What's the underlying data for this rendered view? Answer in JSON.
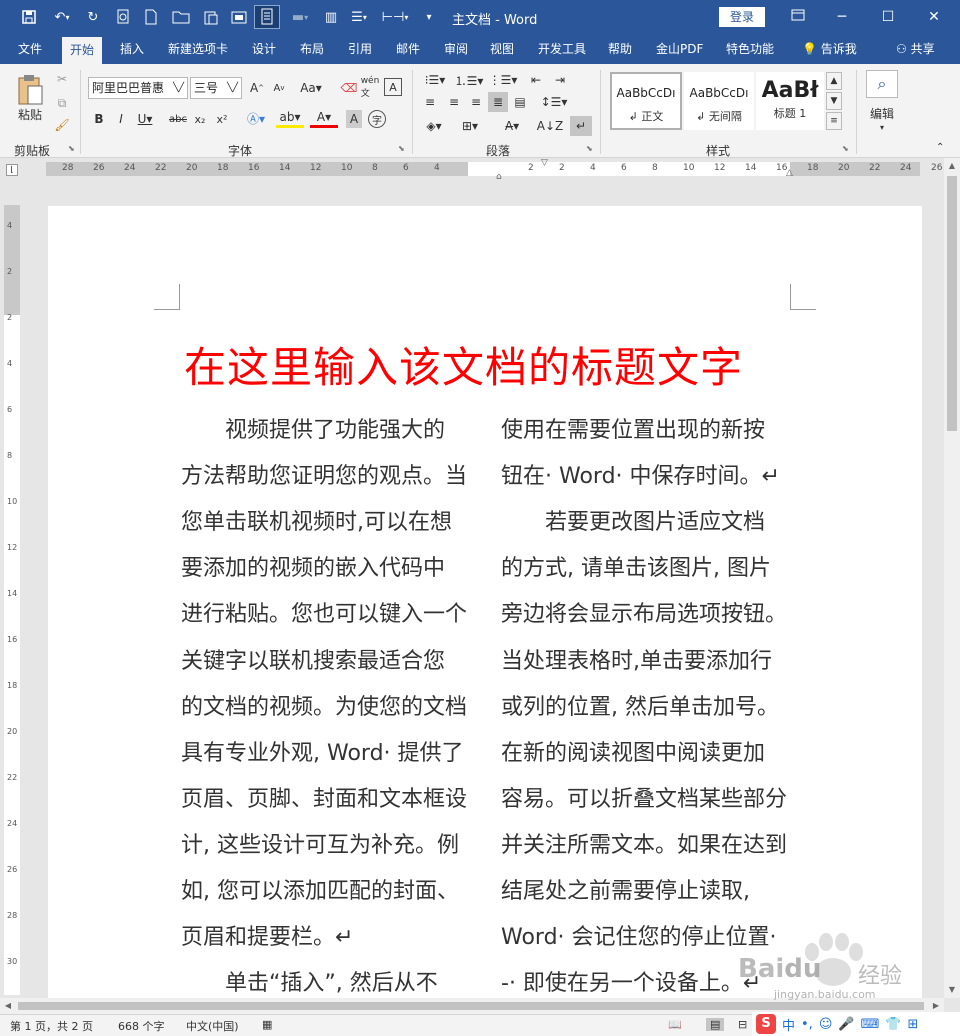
{
  "title_bar": {
    "doc_title": "主文档 - Word",
    "login_label": "登录"
  },
  "tabs": [
    "文件",
    "开始",
    "插入",
    "新建选项卡",
    "设计",
    "布局",
    "引用",
    "邮件",
    "审阅",
    "视图",
    "开发工具",
    "帮助",
    "金山PDF",
    "特色功能",
    "告诉我",
    "共享"
  ],
  "ribbon": {
    "paste_label": "粘贴",
    "font_name": "阿里巴巴普惠",
    "font_size": "三号",
    "groups": [
      "剪贴板",
      "字体",
      "段落",
      "样式",
      "编辑"
    ],
    "styles": [
      {
        "preview": "AaBbCcDı",
        "name": "正文"
      },
      {
        "preview": "AaBbCcDı",
        "name": "无间隔"
      },
      {
        "preview": "AaBł",
        "name": "标题 1"
      }
    ],
    "edit_label": "编辑"
  },
  "ruler": {
    "left_numbers": [
      "28",
      "26",
      "24",
      "22",
      "20",
      "18",
      "16",
      "14",
      "12",
      "10",
      "8",
      "6",
      "4"
    ],
    "right_numbers": [
      "2",
      "2",
      "4",
      "6",
      "8",
      "10",
      "12",
      "14",
      "16",
      "18",
      "20",
      "22",
      "24",
      "26"
    ],
    "vertical_numbers": [
      "4",
      "2",
      "2",
      "4",
      "6",
      "8",
      "10",
      "12",
      "14",
      "16",
      "18",
      "20",
      "22",
      "24",
      "26",
      "28",
      "30"
    ]
  },
  "document": {
    "heading": "在这里输入该文档的标题文字",
    "col1": [
      "　　视频提供了功能强大的",
      "方法帮助您证明您的观点。当",
      "您单击联机视频时,可以在想",
      "要添加的视频的嵌入代码中",
      "进行粘贴。您也可以键入一个",
      "关键字以联机搜索最适合您",
      "的文档的视频。为使您的文档",
      "具有专业外观, Word· 提供了",
      "页眉、页脚、封面和文本框设",
      "计, 这些设计可互为补充。例",
      "如, 您可以添加匹配的封面、",
      "页眉和提要栏。↵",
      "　　单击“插入”, 然后从不"
    ],
    "col2": [
      "使用在需要位置出现的新按",
      "钮在· Word· 中保存时间。↵",
      "　　若要更改图片适应文档",
      "的方式, 请单击该图片, 图片",
      "旁边将会显示布局选项按钮。",
      "当处理表格时,单击要添加行",
      "或列的位置, 然后单击加号。",
      "在新的阅读视图中阅读更加",
      "容易。可以折叠文档某些部分",
      "并关注所需文本。如果在达到",
      "结尾处之前需要停止读取,",
      "Word· 会记住您的停止位置·",
      "-· 即使在另一个设备上。↵"
    ]
  },
  "status_bar": {
    "page": "第 1 页，共 2 页",
    "words": "668 个字",
    "lang": "中文(中国)",
    "ime": "中"
  },
  "watermark": {
    "brand": "Bai",
    "brand2": "du",
    "jingyan": "经验",
    "url": "jingyan.baidu.com"
  }
}
